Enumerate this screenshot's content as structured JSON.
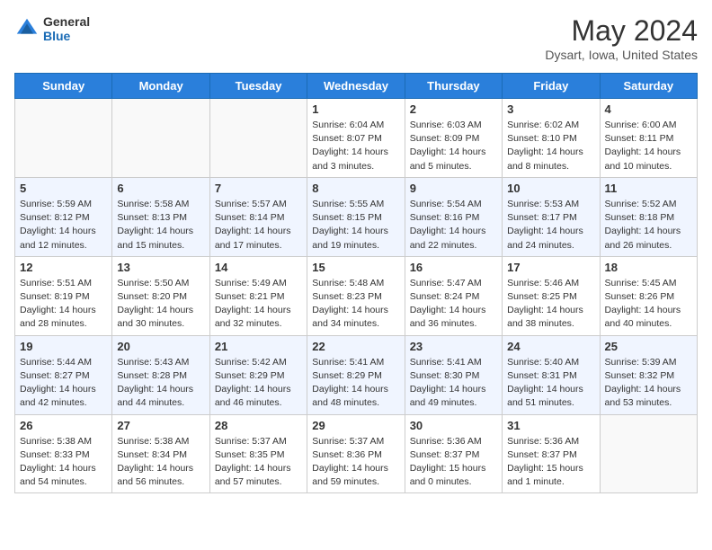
{
  "header": {
    "logo_general": "General",
    "logo_blue": "Blue",
    "month_title": "May 2024",
    "location": "Dysart, Iowa, United States"
  },
  "days_of_week": [
    "Sunday",
    "Monday",
    "Tuesday",
    "Wednesday",
    "Thursday",
    "Friday",
    "Saturday"
  ],
  "weeks": [
    [
      {
        "day": "",
        "info": ""
      },
      {
        "day": "",
        "info": ""
      },
      {
        "day": "",
        "info": ""
      },
      {
        "day": "1",
        "info": "Sunrise: 6:04 AM\nSunset: 8:07 PM\nDaylight: 14 hours\nand 3 minutes."
      },
      {
        "day": "2",
        "info": "Sunrise: 6:03 AM\nSunset: 8:09 PM\nDaylight: 14 hours\nand 5 minutes."
      },
      {
        "day": "3",
        "info": "Sunrise: 6:02 AM\nSunset: 8:10 PM\nDaylight: 14 hours\nand 8 minutes."
      },
      {
        "day": "4",
        "info": "Sunrise: 6:00 AM\nSunset: 8:11 PM\nDaylight: 14 hours\nand 10 minutes."
      }
    ],
    [
      {
        "day": "5",
        "info": "Sunrise: 5:59 AM\nSunset: 8:12 PM\nDaylight: 14 hours\nand 12 minutes."
      },
      {
        "day": "6",
        "info": "Sunrise: 5:58 AM\nSunset: 8:13 PM\nDaylight: 14 hours\nand 15 minutes."
      },
      {
        "day": "7",
        "info": "Sunrise: 5:57 AM\nSunset: 8:14 PM\nDaylight: 14 hours\nand 17 minutes."
      },
      {
        "day": "8",
        "info": "Sunrise: 5:55 AM\nSunset: 8:15 PM\nDaylight: 14 hours\nand 19 minutes."
      },
      {
        "day": "9",
        "info": "Sunrise: 5:54 AM\nSunset: 8:16 PM\nDaylight: 14 hours\nand 22 minutes."
      },
      {
        "day": "10",
        "info": "Sunrise: 5:53 AM\nSunset: 8:17 PM\nDaylight: 14 hours\nand 24 minutes."
      },
      {
        "day": "11",
        "info": "Sunrise: 5:52 AM\nSunset: 8:18 PM\nDaylight: 14 hours\nand 26 minutes."
      }
    ],
    [
      {
        "day": "12",
        "info": "Sunrise: 5:51 AM\nSunset: 8:19 PM\nDaylight: 14 hours\nand 28 minutes."
      },
      {
        "day": "13",
        "info": "Sunrise: 5:50 AM\nSunset: 8:20 PM\nDaylight: 14 hours\nand 30 minutes."
      },
      {
        "day": "14",
        "info": "Sunrise: 5:49 AM\nSunset: 8:21 PM\nDaylight: 14 hours\nand 32 minutes."
      },
      {
        "day": "15",
        "info": "Sunrise: 5:48 AM\nSunset: 8:23 PM\nDaylight: 14 hours\nand 34 minutes."
      },
      {
        "day": "16",
        "info": "Sunrise: 5:47 AM\nSunset: 8:24 PM\nDaylight: 14 hours\nand 36 minutes."
      },
      {
        "day": "17",
        "info": "Sunrise: 5:46 AM\nSunset: 8:25 PM\nDaylight: 14 hours\nand 38 minutes."
      },
      {
        "day": "18",
        "info": "Sunrise: 5:45 AM\nSunset: 8:26 PM\nDaylight: 14 hours\nand 40 minutes."
      }
    ],
    [
      {
        "day": "19",
        "info": "Sunrise: 5:44 AM\nSunset: 8:27 PM\nDaylight: 14 hours\nand 42 minutes."
      },
      {
        "day": "20",
        "info": "Sunrise: 5:43 AM\nSunset: 8:28 PM\nDaylight: 14 hours\nand 44 minutes."
      },
      {
        "day": "21",
        "info": "Sunrise: 5:42 AM\nSunset: 8:29 PM\nDaylight: 14 hours\nand 46 minutes."
      },
      {
        "day": "22",
        "info": "Sunrise: 5:41 AM\nSunset: 8:29 PM\nDaylight: 14 hours\nand 48 minutes."
      },
      {
        "day": "23",
        "info": "Sunrise: 5:41 AM\nSunset: 8:30 PM\nDaylight: 14 hours\nand 49 minutes."
      },
      {
        "day": "24",
        "info": "Sunrise: 5:40 AM\nSunset: 8:31 PM\nDaylight: 14 hours\nand 51 minutes."
      },
      {
        "day": "25",
        "info": "Sunrise: 5:39 AM\nSunset: 8:32 PM\nDaylight: 14 hours\nand 53 minutes."
      }
    ],
    [
      {
        "day": "26",
        "info": "Sunrise: 5:38 AM\nSunset: 8:33 PM\nDaylight: 14 hours\nand 54 minutes."
      },
      {
        "day": "27",
        "info": "Sunrise: 5:38 AM\nSunset: 8:34 PM\nDaylight: 14 hours\nand 56 minutes."
      },
      {
        "day": "28",
        "info": "Sunrise: 5:37 AM\nSunset: 8:35 PM\nDaylight: 14 hours\nand 57 minutes."
      },
      {
        "day": "29",
        "info": "Sunrise: 5:37 AM\nSunset: 8:36 PM\nDaylight: 14 hours\nand 59 minutes."
      },
      {
        "day": "30",
        "info": "Sunrise: 5:36 AM\nSunset: 8:37 PM\nDaylight: 15 hours\nand 0 minutes."
      },
      {
        "day": "31",
        "info": "Sunrise: 5:36 AM\nSunset: 8:37 PM\nDaylight: 15 hours\nand 1 minute."
      },
      {
        "day": "",
        "info": ""
      }
    ]
  ]
}
